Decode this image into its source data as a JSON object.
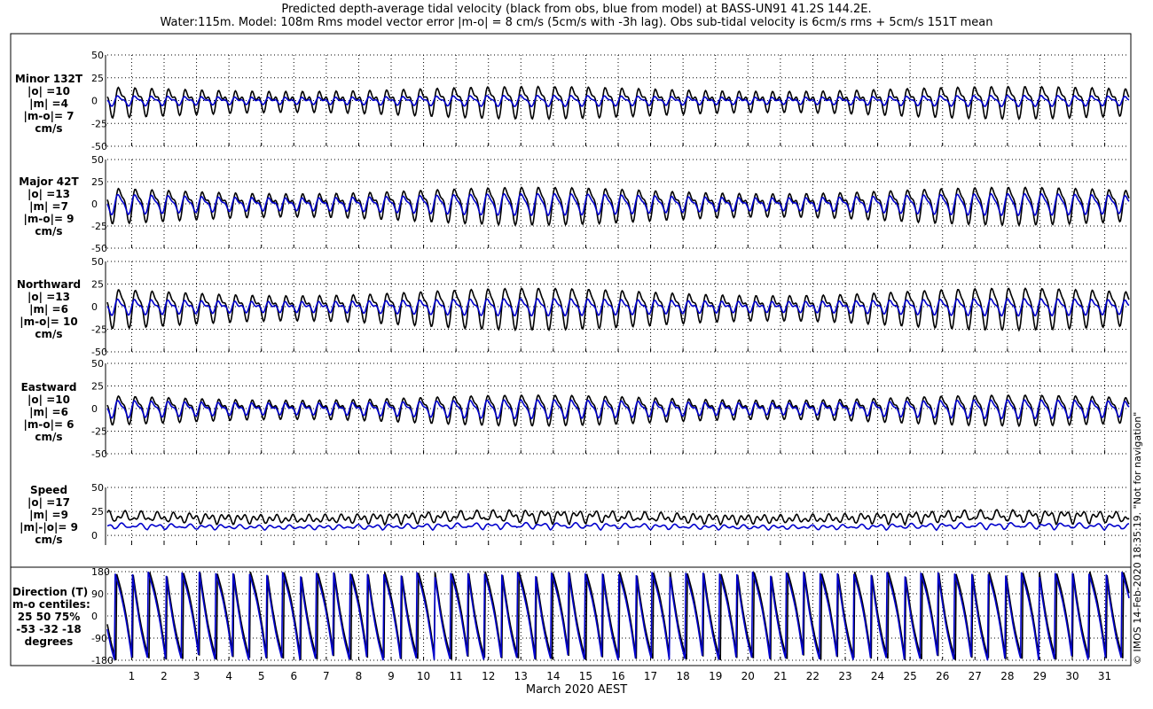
{
  "title_line1": "Predicted depth-average tidal velocity (black from obs, blue from model) at BASS-UN91 41.2S 144.2E.",
  "title_line2": "Water:115m. Model: 108m  Rms model vector error |m-o| = 8 cm/s (5cm/s with -3h lag). Obs sub-tidal velocity is 6cm/s rms + 5cm/s 151T mean",
  "credit": "© IMOS 14-Feb-2020 18:35:19. \"Not for navigation\"",
  "xaxis_label": "March 2020 AEST",
  "colors": {
    "obs": "#000000",
    "model": "#0000cc",
    "grid": "#000000"
  },
  "panels": [
    {
      "label_lines": [
        "Minor 132T",
        "|o| =10",
        "|m| =4",
        "|m-o|= 7",
        "cm/s"
      ]
    },
    {
      "label_lines": [
        "Major 42T",
        "|o| =13",
        "|m| =7",
        "|m-o|= 9",
        "cm/s"
      ]
    },
    {
      "label_lines": [
        "Northward",
        "|o| =13",
        "|m| =6",
        "|m-o|= 10",
        "cm/s"
      ]
    },
    {
      "label_lines": [
        "Eastward",
        "|o| =10",
        "|m| =6",
        "|m-o|= 6",
        "cm/s"
      ]
    },
    {
      "label_lines": [
        "Speed",
        "|o| =17",
        "|m| =9",
        "|m|-|o|= 9",
        "cm/s"
      ]
    },
    {
      "label_lines": [
        "Direction (T)",
        "m-o centiles:",
        "25  50  75%",
        "-53  -32  -18",
        "degrees"
      ]
    }
  ],
  "chart_data": [
    {
      "type": "line",
      "name": "minor",
      "title": "Minor 132T",
      "ylabel": "cm/s",
      "ylim": [
        -50,
        50
      ],
      "yticks": [
        -50,
        -25,
        0,
        25,
        50
      ],
      "ytick_labels": [
        "-50",
        "-25",
        "0",
        "25",
        "50"
      ],
      "xlim": [
        0.25,
        31.75
      ],
      "xticks": [
        1,
        2,
        3,
        4,
        5,
        6,
        7,
        8,
        9,
        10,
        11,
        12,
        13,
        14,
        15,
        16,
        17,
        18,
        19,
        20,
        21,
        22,
        23,
        24,
        25,
        26,
        27,
        28,
        29,
        30,
        31
      ],
      "synthetic": {
        "obs_amp": 15,
        "obs_mod": 6,
        "model_amp": 5,
        "model_mod": 2,
        "offset": 0
      }
    },
    {
      "type": "line",
      "name": "major",
      "title": "Major 42T",
      "ylabel": "cm/s",
      "ylim": [
        -50,
        50
      ],
      "yticks": [
        -50,
        -25,
        0,
        25,
        50
      ],
      "ytick_labels": [
        "-50",
        "-25",
        "0",
        "25",
        "50"
      ],
      "xlim": [
        0.25,
        31.75
      ],
      "xticks": [
        1,
        2,
        3,
        4,
        5,
        6,
        7,
        8,
        9,
        10,
        11,
        12,
        13,
        14,
        15,
        16,
        17,
        18,
        19,
        20,
        21,
        22,
        23,
        24,
        25,
        26,
        27,
        28,
        29,
        30,
        31
      ],
      "synthetic": {
        "obs_amp": 19,
        "obs_mod": 6,
        "model_amp": 11,
        "model_mod": 3,
        "offset": 0
      }
    },
    {
      "type": "line",
      "name": "northward",
      "title": "Northward",
      "ylabel": "cm/s",
      "ylim": [
        -50,
        50
      ],
      "yticks": [
        -50,
        -25,
        0,
        25,
        50
      ],
      "ytick_labels": [
        "-50",
        "-25",
        "0",
        "25",
        "50"
      ],
      "xlim": [
        0.25,
        31.75
      ],
      "xticks": [
        1,
        2,
        3,
        4,
        5,
        6,
        7,
        8,
        9,
        10,
        11,
        12,
        13,
        14,
        15,
        16,
        17,
        18,
        19,
        20,
        21,
        22,
        23,
        24,
        25,
        26,
        27,
        28,
        29,
        30,
        31
      ],
      "synthetic": {
        "obs_amp": 21,
        "obs_mod": 6,
        "model_amp": 8,
        "model_mod": 3,
        "offset": 0
      }
    },
    {
      "type": "line",
      "name": "eastward",
      "title": "Eastward",
      "ylabel": "cm/s",
      "ylim": [
        -50,
        50
      ],
      "yticks": [
        -50,
        -25,
        0,
        25,
        50
      ],
      "ytick_labels": [
        "-50",
        "-25",
        "0",
        "25",
        "50"
      ],
      "xlim": [
        0.25,
        31.75
      ],
      "xticks": [
        1,
        2,
        3,
        4,
        5,
        6,
        7,
        8,
        9,
        10,
        11,
        12,
        13,
        14,
        15,
        16,
        17,
        18,
        19,
        20,
        21,
        22,
        23,
        24,
        25,
        26,
        27,
        28,
        29,
        30,
        31
      ],
      "synthetic": {
        "obs_amp": 15,
        "obs_mod": 5,
        "model_amp": 9,
        "model_mod": 3,
        "offset": 0
      }
    },
    {
      "type": "line",
      "name": "speed",
      "title": "Speed",
      "ylabel": "cm/s",
      "ylim": [
        -10,
        50
      ],
      "yticks": [
        0,
        25,
        50
      ],
      "ytick_labels": [
        "0",
        "25",
        "50"
      ],
      "xlim": [
        0.25,
        31.75
      ],
      "xticks": [
        1,
        2,
        3,
        4,
        5,
        6,
        7,
        8,
        9,
        10,
        11,
        12,
        13,
        14,
        15,
        16,
        17,
        18,
        19,
        20,
        21,
        22,
        23,
        24,
        25,
        26,
        27,
        28,
        29,
        30,
        31
      ],
      "synthetic": {
        "obs_amp": 10,
        "obs_mod": 6,
        "model_amp": 5,
        "model_mod": 2,
        "offset": 14,
        "model_offset": 7
      }
    },
    {
      "type": "line",
      "name": "direction",
      "title": "Direction (T)",
      "ylabel": "degrees",
      "ylim": [
        -180,
        180
      ],
      "yticks": [
        -180,
        -90,
        0,
        90,
        180
      ],
      "ytick_labels": [
        "-180",
        "-90",
        "0",
        "90",
        "180"
      ],
      "xlim": [
        0.25,
        31.75
      ],
      "xticks": [
        1,
        2,
        3,
        4,
        5,
        6,
        7,
        8,
        9,
        10,
        11,
        12,
        13,
        14,
        15,
        16,
        17,
        18,
        19,
        20,
        21,
        22,
        23,
        24,
        25,
        26,
        27,
        28,
        29,
        30,
        31
      ],
      "synthetic": {
        "direction": true
      }
    }
  ]
}
